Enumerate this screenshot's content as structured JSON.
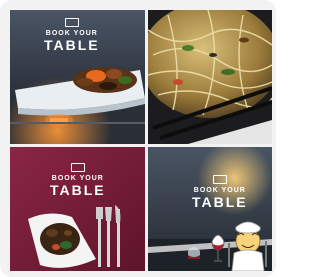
{
  "tiles": [
    {
      "brand_small": "BOOK YOUR",
      "brand_big": "TABLE"
    },
    {
      "brand_small": "",
      "brand_big": ""
    },
    {
      "brand_small": "BOOK YOUR",
      "brand_big": "TABLE"
    },
    {
      "brand_small": "BOOK YOUR",
      "brand_big": "TABLE"
    }
  ],
  "badge": {
    "icon": "dining-emoji-icon"
  }
}
